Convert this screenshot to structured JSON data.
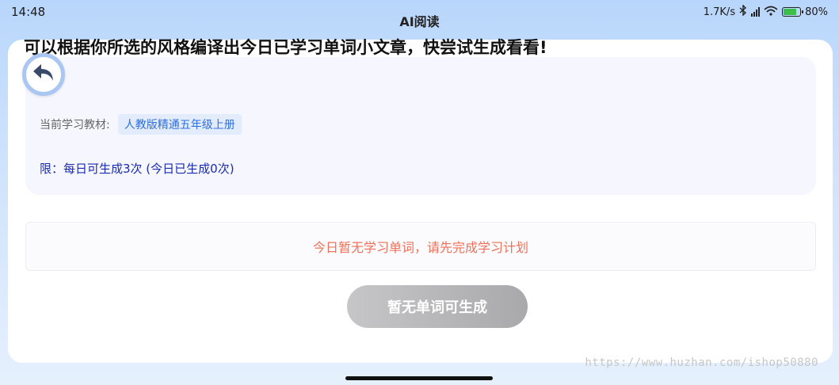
{
  "status_bar": {
    "time": "14:48",
    "title": "AI阅读",
    "net_speed": "1.7K/s",
    "battery": "80%",
    "battery_level": 0.8
  },
  "info": {
    "headline": "可以根据你所选的风格编译出今日已学习单词小文章，快尝试生成看看!",
    "textbook_label": "当前学习教材:",
    "textbook_name": "人教版精通五年级上册",
    "limit": "限：每日可生成3次 (今日已生成0次)"
  },
  "notice": "今日暂无学习单词，请先完成学习计划",
  "generate_button_label": "暂无单词可生成",
  "watermark": "https://www.huzhan.com/ishop50880",
  "icons": {
    "back": "back-arrow-icon",
    "bluetooth": "bluetooth-icon",
    "signal": "signal-icon",
    "wifi": "wifi-icon",
    "battery": "battery-icon"
  },
  "colors": {
    "accent_blue": "#2f6fe0",
    "limit_text": "#1a2bb0",
    "notice_text": "#f0715a",
    "button_disabled": "#b5b5b7"
  }
}
